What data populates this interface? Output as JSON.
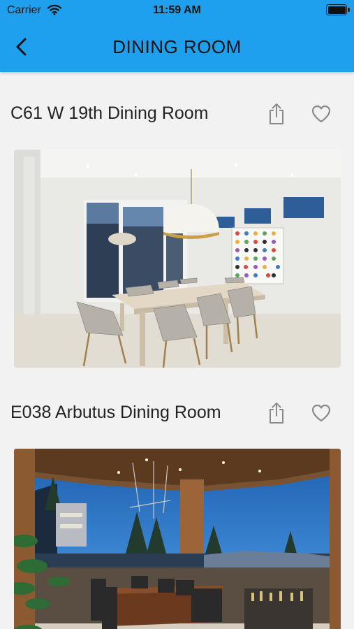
{
  "status_bar": {
    "carrier": "Carrier",
    "time": "11:59 AM"
  },
  "nav": {
    "title": "DINING ROOM"
  },
  "colors": {
    "accent": "#1ea0ee",
    "background": "#f2f2f2",
    "icon_gray": "#8a8a8a"
  },
  "listings": [
    {
      "title": "C61 W 19th Dining Room",
      "share_icon": "share-icon",
      "favorite_icon": "heart-outline-icon"
    },
    {
      "title": "E038 Arbutus Dining Room",
      "share_icon": "share-icon",
      "favorite_icon": "heart-outline-icon"
    }
  ]
}
